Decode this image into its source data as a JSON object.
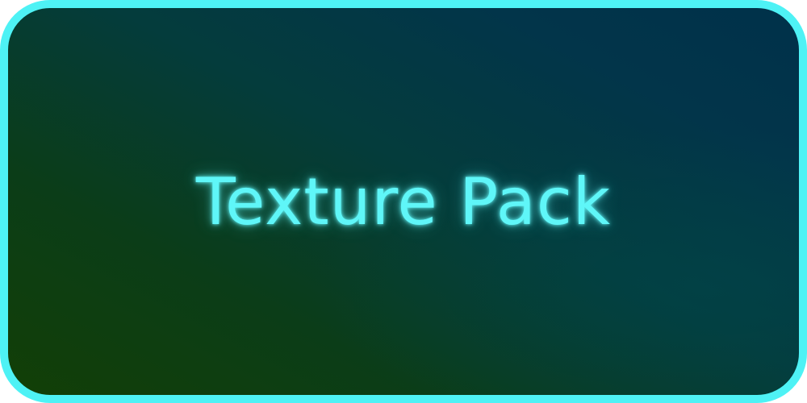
{
  "button": {
    "label": "Texture Pack"
  },
  "colors": {
    "border": "#4ef2f5",
    "text": "#5ff6f8",
    "background_start": "#123f06",
    "background_end": "#00314a"
  }
}
